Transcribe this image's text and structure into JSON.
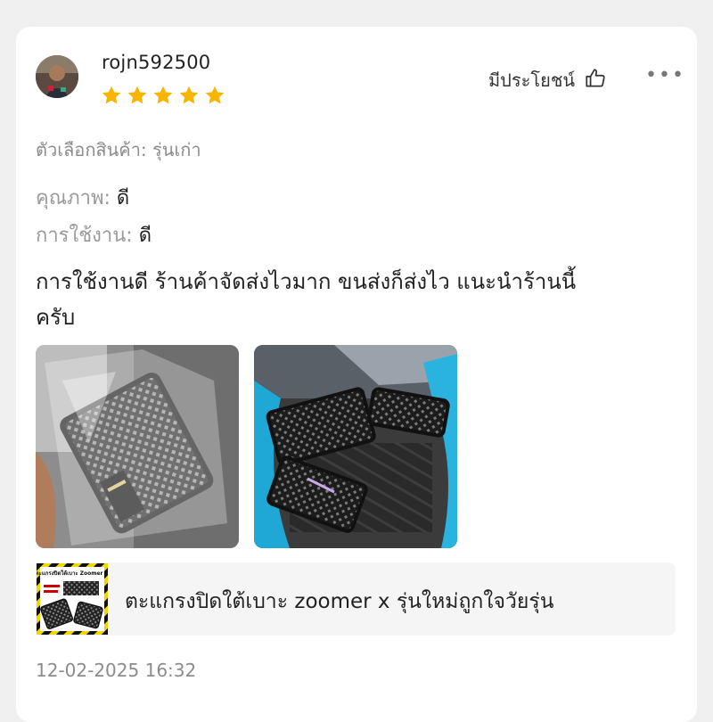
{
  "review": {
    "username": "rojn592500",
    "rating": 5,
    "rating_max": 5,
    "helpful_label": "มีประโยชน์",
    "more_label": "•••",
    "variant_label": "ตัวเลือกสินค้า:",
    "variant_value": "รุ่นเก่า",
    "attributes": [
      {
        "label": "คุณภาพ:",
        "value": "ดี"
      },
      {
        "label": "การใช้งาน:",
        "value": "ดี"
      }
    ],
    "text_line1": "การใช้งานดี ร้านค้าจัดส่งไวมาก ขนส่งก็ส่งไว แนะนำร้านนี้",
    "text_line2": "ครับ",
    "timestamp": "12-02-2025 16:32"
  },
  "product": {
    "name": "ตะแกรงปิดใต้เบาะ zoomer x รุ่นใหม่ถูกใจวัยรุ่น",
    "thumb_text": "ตะแกรงปิดใต้เบาะ Zoomer X"
  },
  "colors": {
    "star": "#f7b500",
    "text": "#222222",
    "muted": "#8c8c8c",
    "thumb_border": "#f2d600"
  }
}
